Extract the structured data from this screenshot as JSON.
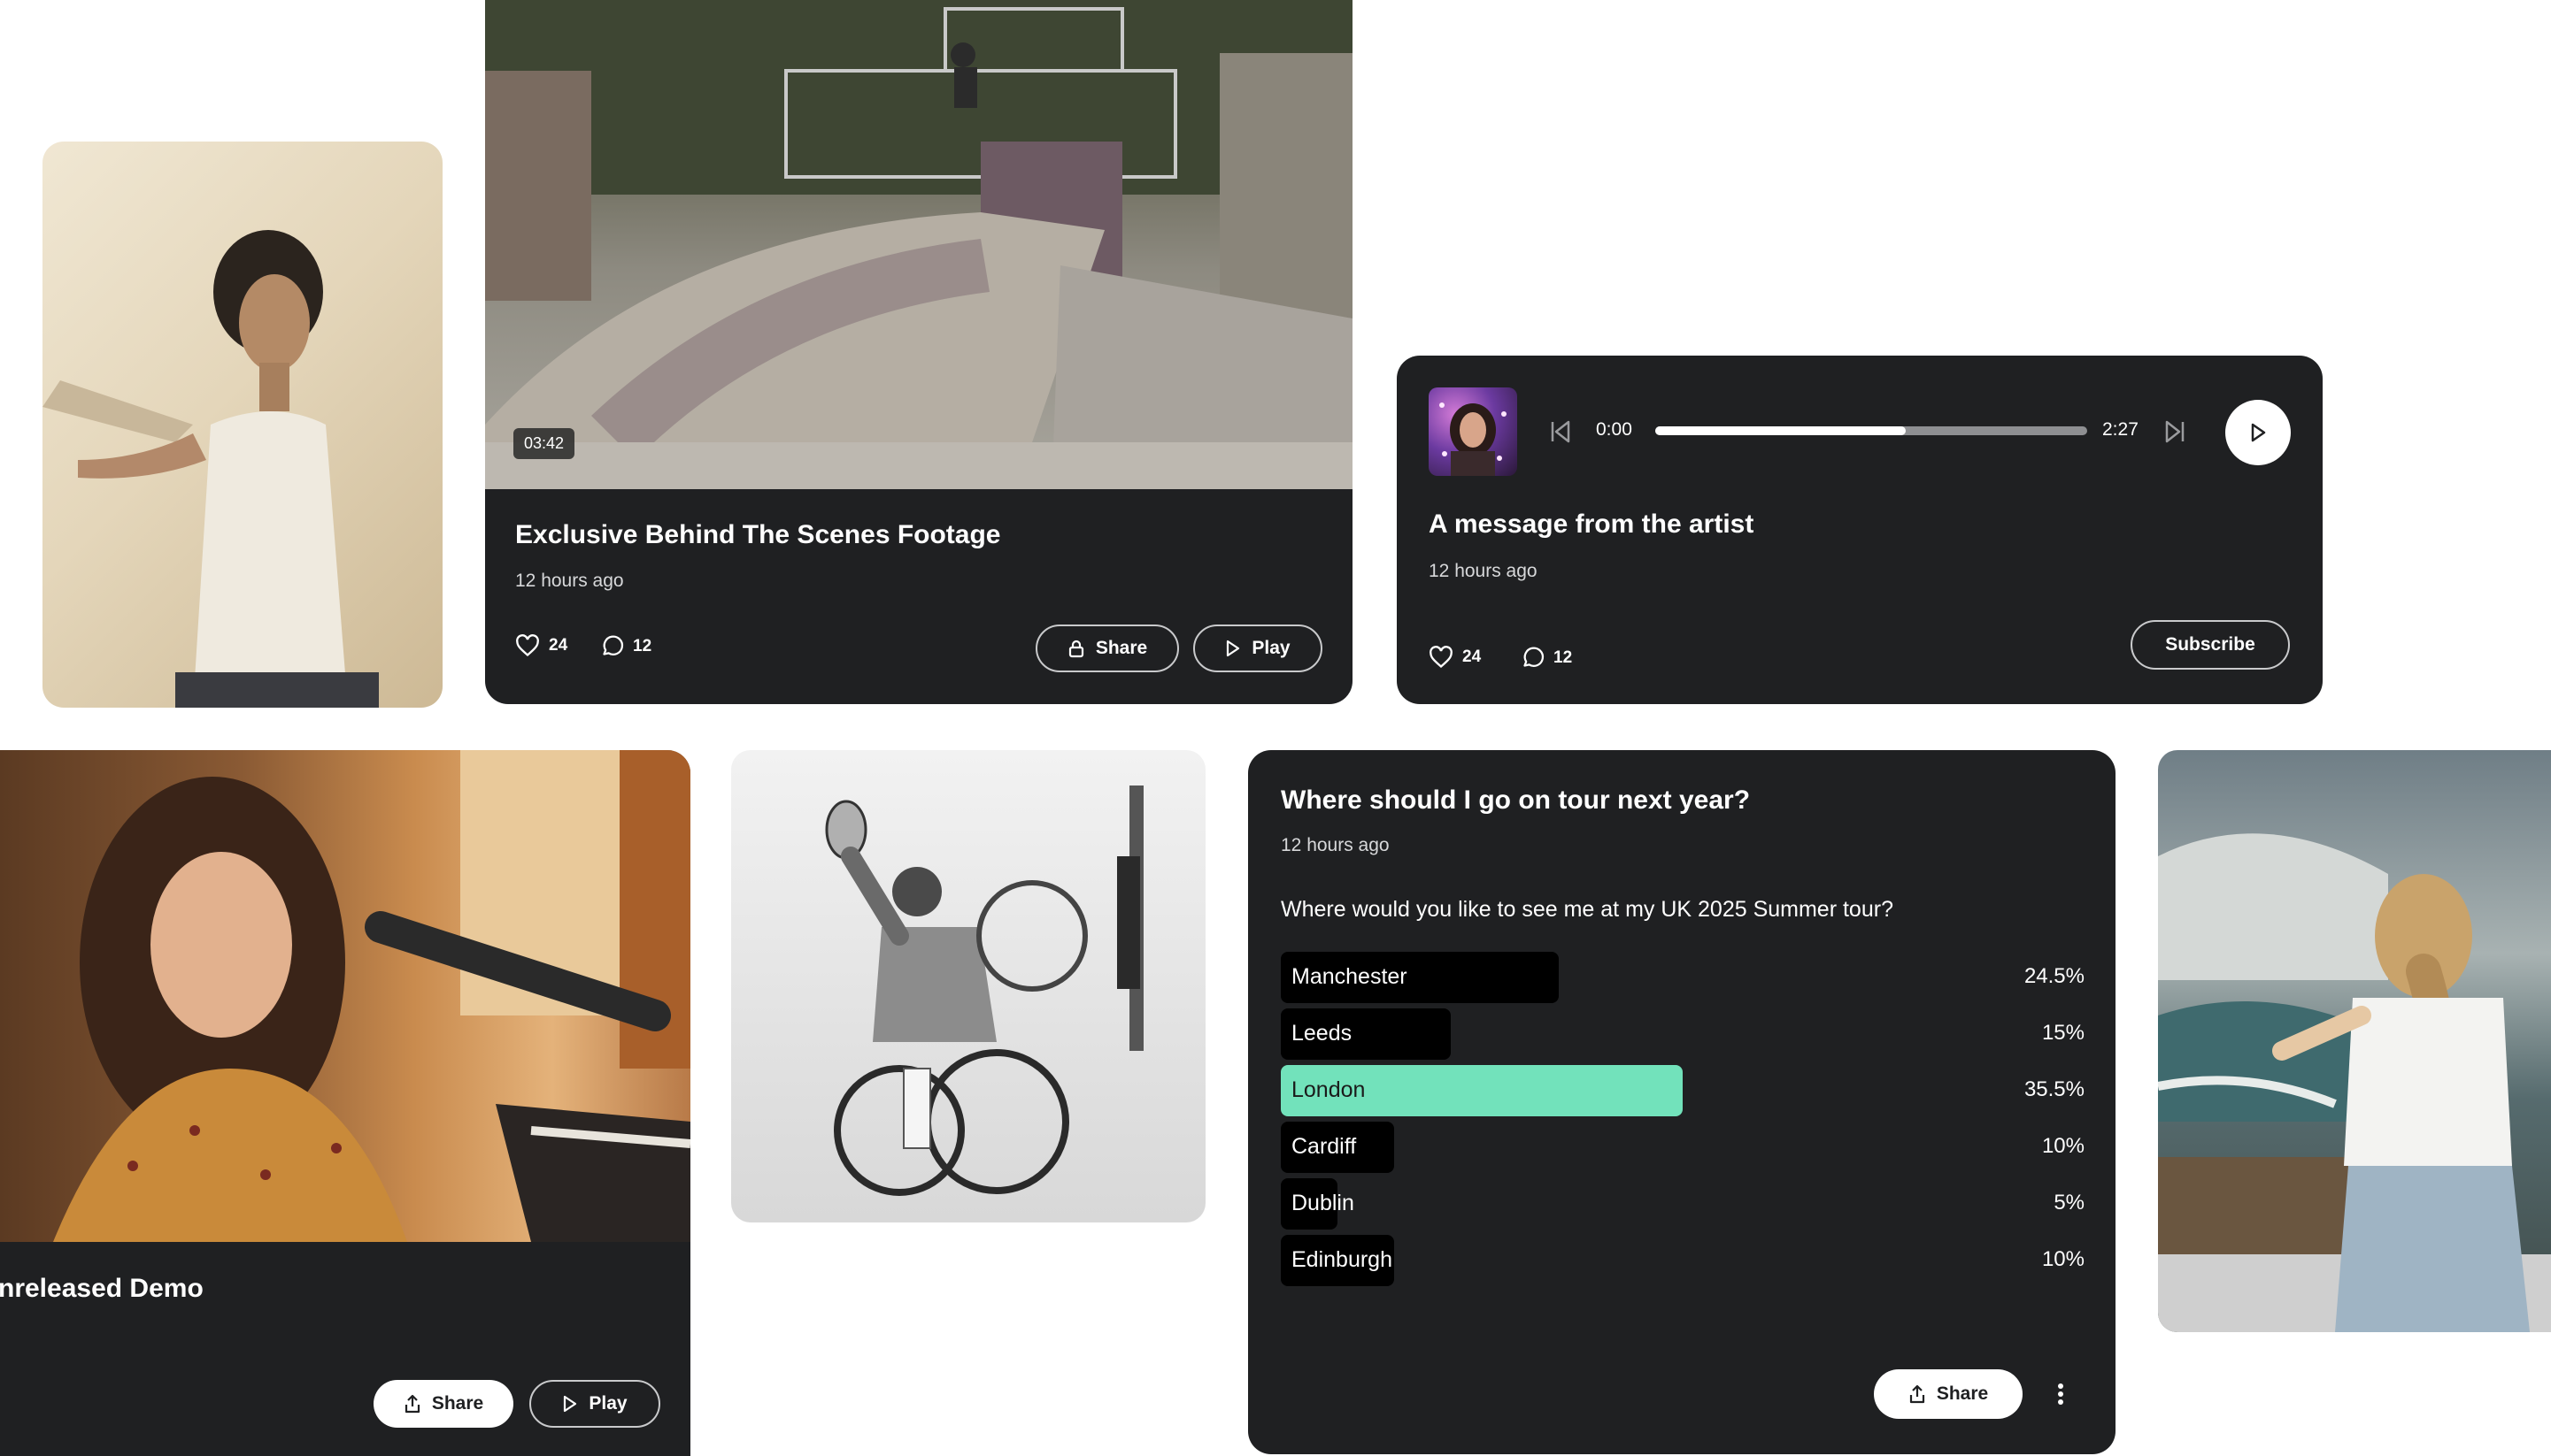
{
  "video_card": {
    "duration": "03:42",
    "title": "Exclusive Behind The Scenes Footage",
    "time_ago": "12 hours ago",
    "likes": "24",
    "comments": "12",
    "share_label": "Share",
    "play_label": "Play"
  },
  "audio_card": {
    "current_time": "0:00",
    "total_time": "2:27",
    "progress": 0.58,
    "title": "A message from the artist",
    "time_ago": "12 hours ago",
    "likes": "24",
    "comments": "12",
    "subscribe_label": "Subscribe"
  },
  "demo_card": {
    "title": "nreleased Demo",
    "share_label": "Share",
    "play_label": "Play"
  },
  "poll_card": {
    "title": "Where should I go on tour next year?",
    "time_ago": "12 hours ago",
    "question": "Where would you like to see me at my UK 2025 Summer tour?",
    "options": [
      {
        "label": "Manchester",
        "percent": "24.5%",
        "value": 24.5
      },
      {
        "label": "Leeds",
        "percent": "15%",
        "value": 15
      },
      {
        "label": "London",
        "percent": "35.5%",
        "value": 35.5,
        "winner": true
      },
      {
        "label": "Cardiff",
        "percent": "10%",
        "value": 10
      },
      {
        "label": "Dublin",
        "percent": "5%",
        "value": 5
      },
      {
        "label": "Edinburgh",
        "percent": "10%",
        "value": 10
      }
    ],
    "share_label": "Share"
  },
  "colors": {
    "card_bg": "#1f2022",
    "winner_bar": "#72e2bb",
    "bar": "#000000"
  }
}
